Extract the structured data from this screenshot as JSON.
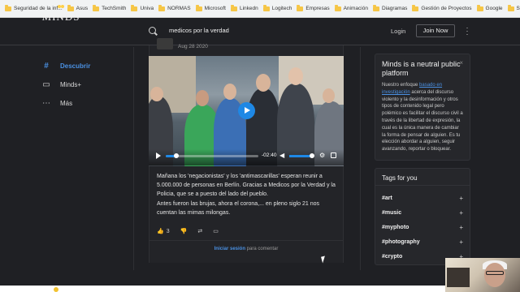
{
  "bookmarks": [
    "Seguridad de la inf...",
    "Asus",
    "TechSmith",
    "Univa",
    "NORMAS",
    "Microsoft",
    "Linkedn",
    "Logitech",
    "Empresas",
    "Animación",
    "Diagramas",
    "Gestión de Proyectos",
    "Google",
    "Streaming Video"
  ],
  "header": {
    "logo": "MINDS",
    "search_query": "medicos por la verdad",
    "login_label": "Login",
    "join_label": "Join Now",
    "more_icon": "kebab-menu-icon"
  },
  "nav": {
    "items": [
      {
        "icon": "#",
        "label": "Descubrir",
        "active": true
      },
      {
        "icon": "▭",
        "label": "Minds+",
        "active": false
      },
      {
        "icon": "⋯",
        "label": "Más",
        "active": false
      }
    ]
  },
  "post": {
    "date": "Aug 28 2020",
    "video": {
      "time_remaining": "-02:40",
      "progress": 0.1,
      "volume": 0.85
    },
    "text": [
      "Mañana los 'negacionistas' y los 'antimascarillas' esperan reunir a 5.000.000 de personas en Berlín. Gracias a Medicos por la Verdad y la Policia, que se a puesto del lado del pueblo.",
      "Antes fueron las brujas, ahora el corona,... en pleno siglo 21 nos cuentan las mimas milongas."
    ],
    "vote_up_count": "3",
    "comment_prompt_link": "Iniciar sesión",
    "comment_prompt_rest": " para comentar"
  },
  "sidebar": {
    "neutral": {
      "title": "Minds is a neutral public platform",
      "body_before": "Nuestro enfoque ",
      "body_link": "basado en investigación",
      "body_after": " acerca del discurso violento y la desinformación y otros tipos de contenido legal pero polémico es facilitar el discurso civil a través de la libertad de expresión, la cual es la única manera de cambiar la forma de pensar de alguien. Es tu elección abordar a alguien, seguir avanzando, reportar o bloquear.",
      "close": "×"
    },
    "tags": {
      "title": "Tags for you",
      "items": [
        "#art",
        "#music",
        "#myphoto",
        "#photography",
        "#crypto"
      ],
      "add": "+"
    }
  },
  "colors": {
    "accent": "#4a90e2",
    "play_button": "#1e88e5",
    "background": "#1f2024",
    "folder": "#f6c646"
  }
}
